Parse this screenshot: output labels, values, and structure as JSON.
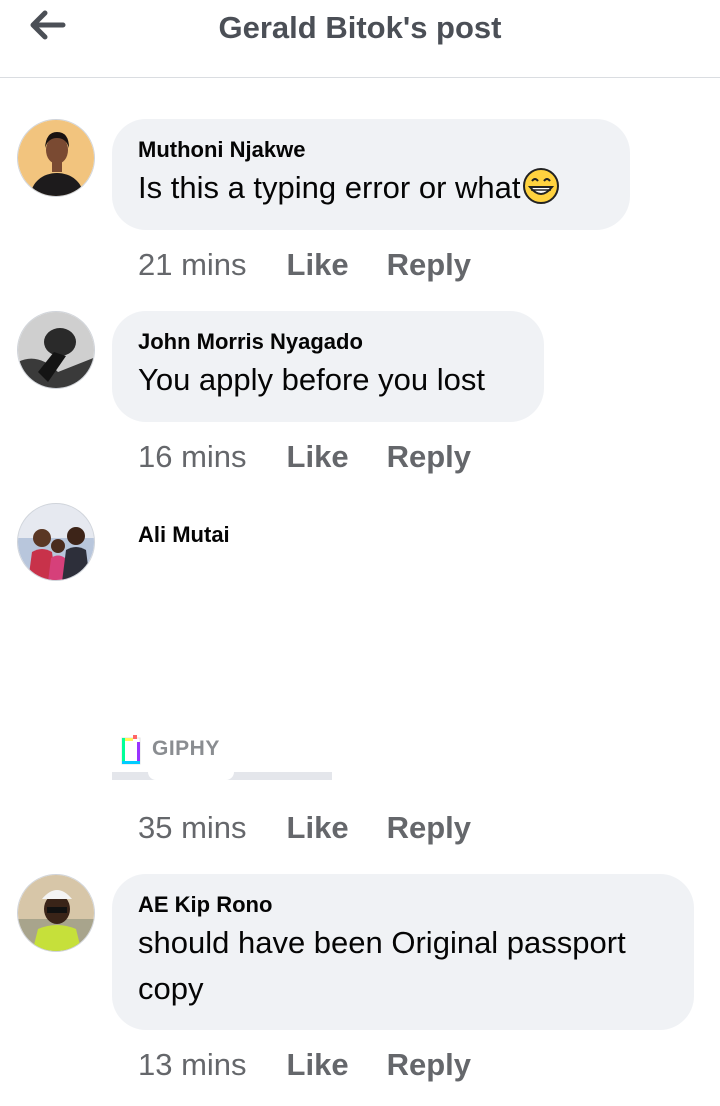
{
  "header": {
    "title": "Gerald Bitok's post",
    "back_icon": "arrow-left-icon"
  },
  "comments": [
    {
      "author": "Muthoni Njakwe",
      "text": "Is this a typing error or what",
      "emoji": "grinning-face-icon",
      "time": "21 mins",
      "like": "Like",
      "reply": "Reply"
    },
    {
      "author": "John Morris Nyagado",
      "text": "You apply before you lost",
      "time": "16 mins",
      "like": "Like",
      "reply": "Reply"
    },
    {
      "author": "Ali Mutai",
      "attachment": "GIPHY",
      "time": "35 mins",
      "like": "Like",
      "reply": "Reply"
    },
    {
      "author": "AE Kip Rono",
      "text_line1": "should have been Original passport",
      "text_line2": "copy",
      "time": "13 mins",
      "like": "Like",
      "reply": "Reply"
    }
  ]
}
